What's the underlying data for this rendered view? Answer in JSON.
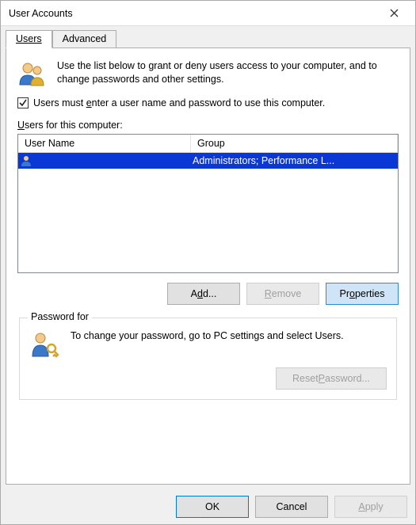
{
  "titlebar": {
    "title": "User Accounts"
  },
  "tabs": [
    {
      "label": "Users",
      "active": true,
      "u": 0
    },
    {
      "label": "Advanced",
      "active": false
    }
  ],
  "intro": "Use the list below to grant or deny users access to your computer, and to change passwords and other settings.",
  "require_login": {
    "checked": true,
    "pre": "Users must ",
    "u": "e",
    "post": "nter a user name and password to use this computer."
  },
  "list_label": {
    "u": "U",
    "rest": "sers for this computer:"
  },
  "columns": {
    "name": "User Name",
    "group": "Group"
  },
  "rows": [
    {
      "name": "",
      "group": "Administrators; Performance L...",
      "selected": true
    }
  ],
  "buttons": {
    "add": {
      "pre": "A",
      "u": "d",
      "post": "d..."
    },
    "remove": {
      "u": "R",
      "rest": "emove"
    },
    "props": {
      "pre": "Pr",
      "u": "o",
      "post": "perties"
    }
  },
  "password_group": {
    "legend": "Password for ",
    "text": "To change your password, go to PC settings and select Users.",
    "reset": {
      "pre": "Reset ",
      "u": "P",
      "post": "assword..."
    }
  },
  "dialog_buttons": {
    "ok": "OK",
    "cancel": "Cancel",
    "apply": {
      "u": "A",
      "rest": "pply"
    }
  }
}
